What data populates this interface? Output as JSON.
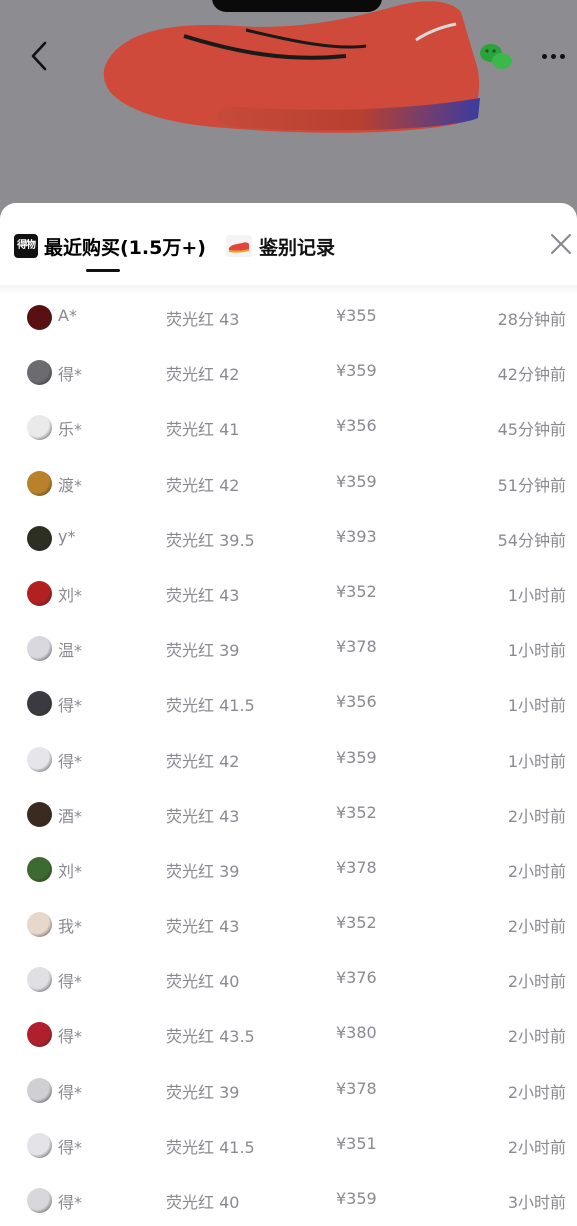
{
  "header": {
    "back_icon": "chevron-left-icon",
    "share_icon": "wechat-icon",
    "more_icon": "more-dots-icon"
  },
  "tabs": {
    "recent_logo": "得物",
    "recent_label": "最近购买(1.5万+)",
    "auth_label": "鉴别记录"
  },
  "colors": {
    "avatars": [
      "#5a1010",
      "#6b6b70",
      "#eaeaea",
      "#b9822a",
      "#2c2f22",
      "#b32020",
      "#d8d8de",
      "#3a3a40",
      "#e6e6ea",
      "#3a2a20",
      "#3c6a30",
      "#e8d8cc",
      "#e0e0e4",
      "#b0202c",
      "#cfcfd4",
      "#e4e4e8",
      "#d8d8dc"
    ]
  },
  "purchases": [
    {
      "user": "A*",
      "variant": "荧光红 43",
      "price": "¥355",
      "time": "28分钟前"
    },
    {
      "user": "得*",
      "variant": "荧光红 42",
      "price": "¥359",
      "time": "42分钟前"
    },
    {
      "user": "乐*",
      "variant": "荧光红 41",
      "price": "¥356",
      "time": "45分钟前"
    },
    {
      "user": "渡*",
      "variant": "荧光红 42",
      "price": "¥359",
      "time": "51分钟前"
    },
    {
      "user": "y*",
      "variant": "荧光红 39.5",
      "price": "¥393",
      "time": "54分钟前"
    },
    {
      "user": "刘*",
      "variant": "荧光红 43",
      "price": "¥352",
      "time": "1小时前"
    },
    {
      "user": "温*",
      "variant": "荧光红 39",
      "price": "¥378",
      "time": "1小时前"
    },
    {
      "user": "得*",
      "variant": "荧光红 41.5",
      "price": "¥356",
      "time": "1小时前"
    },
    {
      "user": "得*",
      "variant": "荧光红 42",
      "price": "¥359",
      "time": "1小时前"
    },
    {
      "user": "酒*",
      "variant": "荧光红 43",
      "price": "¥352",
      "time": "2小时前"
    },
    {
      "user": "刘*",
      "variant": "荧光红 39",
      "price": "¥378",
      "time": "2小时前"
    },
    {
      "user": "我*",
      "variant": "荧光红 43",
      "price": "¥352",
      "time": "2小时前"
    },
    {
      "user": "得*",
      "variant": "荧光红 40",
      "price": "¥376",
      "time": "2小时前"
    },
    {
      "user": "得*",
      "variant": "荧光红 43.5",
      "price": "¥380",
      "time": "2小时前"
    },
    {
      "user": "得*",
      "variant": "荧光红 39",
      "price": "¥378",
      "time": "2小时前"
    },
    {
      "user": "得*",
      "variant": "荧光红 41.5",
      "price": "¥351",
      "time": "2小时前"
    },
    {
      "user": "得*",
      "variant": "荧光红 40",
      "price": "¥359",
      "time": "3小时前"
    }
  ]
}
